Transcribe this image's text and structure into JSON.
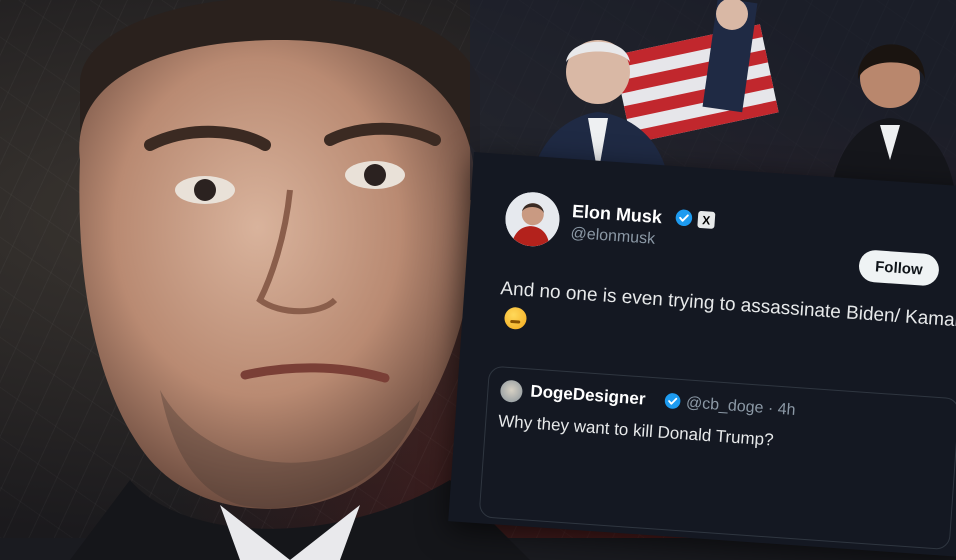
{
  "tweet": {
    "author_name": "Elon Musk",
    "author_handle": "@elonmusk",
    "affiliate_badge": "X",
    "follow_label": "Follow",
    "text": "And no one is even trying to assassinate Biden/ Kamala",
    "emoji": "thinking-face-icon",
    "quote": {
      "author_name": "DogeDesigner",
      "author_handle": "@cb_doge · 4h",
      "text": "Why they want to kill Donald Trump?"
    }
  },
  "colors": {
    "card_bg": "#141822",
    "verified_blue": "#1d9bf0",
    "muted_text": "#8b98a5",
    "follow_bg": "#eff3f4"
  }
}
